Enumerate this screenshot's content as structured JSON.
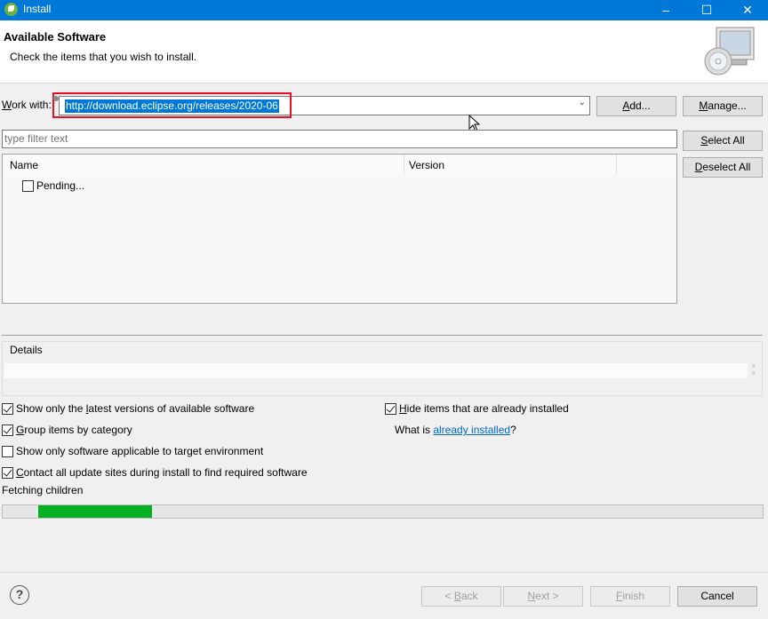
{
  "window": {
    "title": "Install",
    "controls": [
      "minimize",
      "maximize",
      "close"
    ]
  },
  "header": {
    "title": "Available Software",
    "subtitle": "Check the items that you wish to install."
  },
  "work_with": {
    "label_pre": "W",
    "label_rest": "ork with:",
    "value": "http://download.eclipse.org/releases/2020-06"
  },
  "buttons": {
    "add": {
      "u": "A",
      "rest": "dd..."
    },
    "manage": {
      "u": "M",
      "rest": "anage..."
    },
    "select_all": {
      "u": "S",
      "rest": "elect All"
    },
    "deselect_all": {
      "u": "D",
      "rest": "eselect All"
    },
    "back": {
      "pre": "< ",
      "u": "B",
      "rest": "ack"
    },
    "next": {
      "u": "N",
      "rest": "ext >"
    },
    "finish": {
      "u": "F",
      "rest": "inish"
    },
    "cancel": "Cancel"
  },
  "filter": {
    "placeholder": "type filter text"
  },
  "table": {
    "columns": [
      "Name",
      "Version"
    ],
    "rows": [
      {
        "name": "Pending...",
        "checked": false
      }
    ]
  },
  "details": {
    "label": "Details"
  },
  "options": {
    "latest": {
      "checked": true,
      "pre": "Show only the ",
      "u": "l",
      "rest": "atest versions of available software"
    },
    "group": {
      "checked": true,
      "pre": "",
      "u": "G",
      "rest": "roup items by category"
    },
    "target": {
      "checked": false,
      "pre": "Show only software applicable to target environment",
      "u": "",
      "rest": ""
    },
    "contact": {
      "checked": true,
      "pre": "",
      "u": "C",
      "rest": "ontact all update sites during install to find required software"
    },
    "hide": {
      "checked": true,
      "pre": "",
      "u": "H",
      "rest": "ide items that are already installed"
    }
  },
  "installed": {
    "pre": "What is ",
    "link": "already installed",
    "post": "?"
  },
  "status": {
    "text": "Fetching children"
  },
  "progress": {
    "fraction": 0.15,
    "color": "#06b025"
  },
  "colors": {
    "accent": "#0078d7",
    "highlight_box": "#e81123",
    "selection": "#0078d7",
    "link": "#0066cc"
  }
}
